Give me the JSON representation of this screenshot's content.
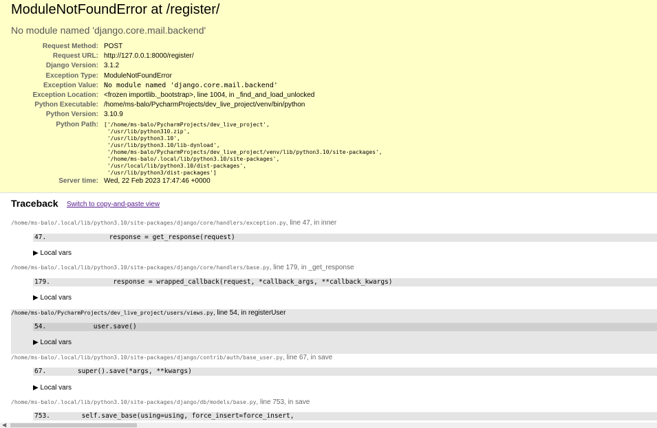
{
  "summary": {
    "title": "ModuleNotFoundError at /register/",
    "subtitle": "No module named 'django.core.mail.backend'",
    "meta": [
      {
        "label": "Request Method:",
        "value": "POST",
        "mono": false
      },
      {
        "label": "Request URL:",
        "value": "http://127.0.0.1:8000/register/",
        "mono": false
      },
      {
        "label": "Django Version:",
        "value": "3.1.2",
        "mono": false
      },
      {
        "label": "Exception Type:",
        "value": "ModuleNotFoundError",
        "mono": false
      },
      {
        "label": "Exception Value:",
        "value": "No module named 'django.core.mail.backend'",
        "mono": true
      },
      {
        "label": "Exception Location:",
        "value": "<frozen importlib._bootstrap>, line 1004, in _find_and_load_unlocked",
        "mono": false
      },
      {
        "label": "Python Executable:",
        "value": "/home/ms-balo/PycharmProjects/dev_live_project/venv/bin/python",
        "mono": false
      },
      {
        "label": "Python Version:",
        "value": "3.10.9",
        "mono": false
      }
    ],
    "python_path_label": "Python Path:",
    "python_path": "['/home/ms-balo/PycharmProjects/dev_live_project',\n '/usr/lib/python310.zip',\n '/usr/lib/python3.10',\n '/usr/lib/python3.10/lib-dynload',\n '/home/ms-balo/PycharmProjects/dev_live_project/venv/lib/python3.10/site-packages',\n '/home/ms-balo/.local/lib/python3.10/site-packages',\n '/usr/local/lib/python3.10/dist-packages',\n '/usr/lib/python3/dist-packages']",
    "server_time_label": "Server time:",
    "server_time": "Wed, 22 Feb 2023 17:47:46 +0000"
  },
  "traceback": {
    "title": "Traceback",
    "switch_link": "Switch to copy-and-paste view",
    "frames": [
      {
        "path": "/home/ms-balo/.local/lib/python3.10/site-packages/django/core/handlers/exception.py",
        "location": ", line 47, in inner",
        "line_no": "47.",
        "code": "                response = get_response(request)",
        "vars_label": "▶ Local vars"
      },
      {
        "path": "/home/ms-balo/.local/lib/python3.10/site-packages/django/core/handlers/base.py",
        "location": ", line 179, in _get_response",
        "line_no": "179.",
        "code": "                response = wrapped_callback(request, *callback_args, **callback_kwargs)",
        "vars_label": "▶ Local vars"
      },
      {
        "path": "/home/ms-balo/PycharmProjects/dev_live_project/users/views.py",
        "location": ", line 54, in registerUser",
        "line_no": "54.",
        "code": "            user.save()",
        "vars_label": "▶ Local vars"
      },
      {
        "path": "/home/ms-balo/.local/lib/python3.10/site-packages/django/contrib/auth/base_user.py",
        "location": ", line 67, in save",
        "line_no": "67.",
        "code": "        super().save(*args, **kwargs)",
        "vars_label": "▶ Local vars"
      },
      {
        "path": "/home/ms-balo/.local/lib/python3.10/site-packages/django/db/models/base.py",
        "location": ", line 753, in save",
        "line_no": "753.",
        "code": "        self.save_base(using=using, force_insert=force_insert,",
        "vars_label": ""
      }
    ]
  },
  "colors": {
    "summary_bg": "#ffffc8",
    "user_frame_bg": "#cfcfcf",
    "link": "#551a8b"
  }
}
